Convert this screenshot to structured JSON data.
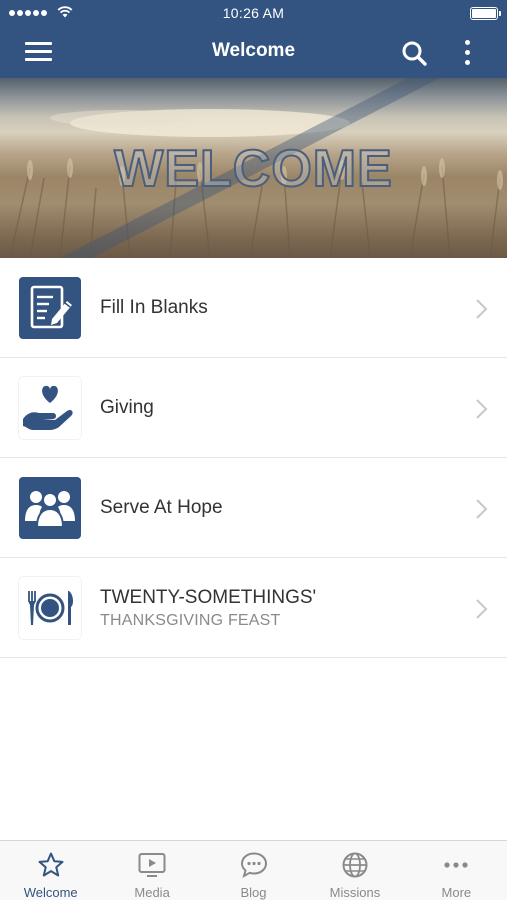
{
  "status_bar": {
    "time": "10:26 AM"
  },
  "nav": {
    "title": "Welcome"
  },
  "banner": {
    "text": "WELCOME"
  },
  "list_items": [
    {
      "title": "Fill In Blanks",
      "subtitle": "",
      "icon": "fill-in-blanks-document-pen-icon"
    },
    {
      "title": "Giving",
      "subtitle": "",
      "icon": "giving-hand-heart-icon"
    },
    {
      "title": "Serve At Hope",
      "subtitle": "",
      "icon": "serve-people-group-icon"
    },
    {
      "title": "TWENTY-SOMETHINGS'",
      "subtitle": "THANKSGIVING FEAST",
      "icon": "plate-fork-knife-icon"
    }
  ],
  "tabs": [
    {
      "label": "Welcome",
      "icon": "star-icon",
      "active": true
    },
    {
      "label": "Media",
      "icon": "tv-play-icon",
      "active": false
    },
    {
      "label": "Blog",
      "icon": "chat-bubble-icon",
      "active": false
    },
    {
      "label": "Missions",
      "icon": "globe-icon",
      "active": false
    },
    {
      "label": "More",
      "icon": "ellipsis-icon",
      "active": false
    }
  ],
  "colors": {
    "brand": "#335480",
    "tab_active": "#335480",
    "tab_inactive": "#8a8a8a",
    "divider": "#e6e6e6"
  }
}
